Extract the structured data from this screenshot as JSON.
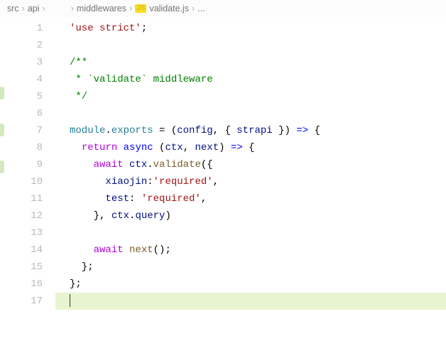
{
  "breadcrumb": {
    "items": [
      "src",
      "api",
      "middlewares",
      "validate.js",
      "..."
    ],
    "blank_after_index": 1
  },
  "code": {
    "line_count": 17,
    "highlighted_line": 17,
    "lines": {
      "l1": {
        "t1": "'use strict'",
        "t2": ";"
      },
      "l3": {
        "t1": "/**"
      },
      "l4": {
        "t1": " * `validate` middleware"
      },
      "l5": {
        "t1": " */"
      },
      "l7": {
        "t1": "module",
        "t2": ".",
        "t3": "exports",
        "t4": " = (",
        "t5": "config",
        "t6": ", { ",
        "t7": "strapi",
        "t8": " }) ",
        "t9": "=>",
        "t10": " {"
      },
      "l8": {
        "t1": "  ",
        "t2": "return",
        "t3": " ",
        "t4": "async",
        "t5": " (",
        "t6": "ctx",
        "t7": ", ",
        "t8": "next",
        "t9": ") ",
        "t10": "=>",
        "t11": " {"
      },
      "l9": {
        "t1": "    ",
        "t2": "await",
        "t3": " ",
        "t4": "ctx",
        "t5": ".",
        "t6": "validate",
        "t7": "({"
      },
      "l10": {
        "t1": "      ",
        "t2": "xiaojin",
        "t3": ":",
        "t4": "'required'",
        "t5": ","
      },
      "l11": {
        "t1": "      ",
        "t2": "test",
        "t3": ": ",
        "t4": "'required'",
        "t5": ","
      },
      "l12": {
        "t1": "    }, ",
        "t2": "ctx",
        "t3": ".",
        "t4": "query",
        "t5": ")"
      },
      "l14": {
        "t1": "    ",
        "t2": "await",
        "t3": " ",
        "t4": "next",
        "t5": "();"
      },
      "l15": {
        "t1": "  };"
      },
      "l16": {
        "t1": "};"
      }
    }
  }
}
